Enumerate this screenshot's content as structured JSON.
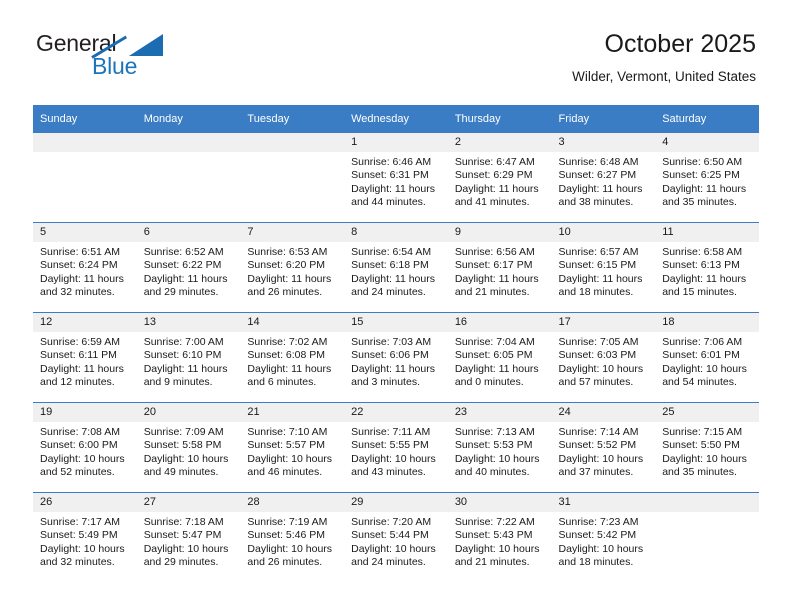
{
  "brand": {
    "name_part1": "General",
    "name_part2": "Blue"
  },
  "header": {
    "title": "October 2025",
    "location": "Wilder, Vermont, United States"
  },
  "weekday_headers": [
    "Sunday",
    "Monday",
    "Tuesday",
    "Wednesday",
    "Thursday",
    "Friday",
    "Saturday"
  ],
  "labels": {
    "sunrise_prefix": "Sunrise:",
    "sunset_prefix": "Sunset:",
    "daylight_prefix": "Daylight:"
  },
  "colors": {
    "header_blue": "#3b7dc4",
    "brand_blue": "#1b75bb",
    "daynum_bg": "#f0f0f0",
    "text": "#1a1a1a"
  },
  "weeks": [
    [
      {
        "day": "",
        "empty": true
      },
      {
        "day": "",
        "empty": true
      },
      {
        "day": "",
        "empty": true
      },
      {
        "day": "1",
        "sunrise": "Sunrise: 6:46 AM",
        "sunset": "Sunset: 6:31 PM",
        "daylight": "Daylight: 11 hours and 44 minutes."
      },
      {
        "day": "2",
        "sunrise": "Sunrise: 6:47 AM",
        "sunset": "Sunset: 6:29 PM",
        "daylight": "Daylight: 11 hours and 41 minutes."
      },
      {
        "day": "3",
        "sunrise": "Sunrise: 6:48 AM",
        "sunset": "Sunset: 6:27 PM",
        "daylight": "Daylight: 11 hours and 38 minutes."
      },
      {
        "day": "4",
        "sunrise": "Sunrise: 6:50 AM",
        "sunset": "Sunset: 6:25 PM",
        "daylight": "Daylight: 11 hours and 35 minutes."
      }
    ],
    [
      {
        "day": "5",
        "sunrise": "Sunrise: 6:51 AM",
        "sunset": "Sunset: 6:24 PM",
        "daylight": "Daylight: 11 hours and 32 minutes."
      },
      {
        "day": "6",
        "sunrise": "Sunrise: 6:52 AM",
        "sunset": "Sunset: 6:22 PM",
        "daylight": "Daylight: 11 hours and 29 minutes."
      },
      {
        "day": "7",
        "sunrise": "Sunrise: 6:53 AM",
        "sunset": "Sunset: 6:20 PM",
        "daylight": "Daylight: 11 hours and 26 minutes."
      },
      {
        "day": "8",
        "sunrise": "Sunrise: 6:54 AM",
        "sunset": "Sunset: 6:18 PM",
        "daylight": "Daylight: 11 hours and 24 minutes."
      },
      {
        "day": "9",
        "sunrise": "Sunrise: 6:56 AM",
        "sunset": "Sunset: 6:17 PM",
        "daylight": "Daylight: 11 hours and 21 minutes."
      },
      {
        "day": "10",
        "sunrise": "Sunrise: 6:57 AM",
        "sunset": "Sunset: 6:15 PM",
        "daylight": "Daylight: 11 hours and 18 minutes."
      },
      {
        "day": "11",
        "sunrise": "Sunrise: 6:58 AM",
        "sunset": "Sunset: 6:13 PM",
        "daylight": "Daylight: 11 hours and 15 minutes."
      }
    ],
    [
      {
        "day": "12",
        "sunrise": "Sunrise: 6:59 AM",
        "sunset": "Sunset: 6:11 PM",
        "daylight": "Daylight: 11 hours and 12 minutes."
      },
      {
        "day": "13",
        "sunrise": "Sunrise: 7:00 AM",
        "sunset": "Sunset: 6:10 PM",
        "daylight": "Daylight: 11 hours and 9 minutes."
      },
      {
        "day": "14",
        "sunrise": "Sunrise: 7:02 AM",
        "sunset": "Sunset: 6:08 PM",
        "daylight": "Daylight: 11 hours and 6 minutes."
      },
      {
        "day": "15",
        "sunrise": "Sunrise: 7:03 AM",
        "sunset": "Sunset: 6:06 PM",
        "daylight": "Daylight: 11 hours and 3 minutes."
      },
      {
        "day": "16",
        "sunrise": "Sunrise: 7:04 AM",
        "sunset": "Sunset: 6:05 PM",
        "daylight": "Daylight: 11 hours and 0 minutes."
      },
      {
        "day": "17",
        "sunrise": "Sunrise: 7:05 AM",
        "sunset": "Sunset: 6:03 PM",
        "daylight": "Daylight: 10 hours and 57 minutes."
      },
      {
        "day": "18",
        "sunrise": "Sunrise: 7:06 AM",
        "sunset": "Sunset: 6:01 PM",
        "daylight": "Daylight: 10 hours and 54 minutes."
      }
    ],
    [
      {
        "day": "19",
        "sunrise": "Sunrise: 7:08 AM",
        "sunset": "Sunset: 6:00 PM",
        "daylight": "Daylight: 10 hours and 52 minutes."
      },
      {
        "day": "20",
        "sunrise": "Sunrise: 7:09 AM",
        "sunset": "Sunset: 5:58 PM",
        "daylight": "Daylight: 10 hours and 49 minutes."
      },
      {
        "day": "21",
        "sunrise": "Sunrise: 7:10 AM",
        "sunset": "Sunset: 5:57 PM",
        "daylight": "Daylight: 10 hours and 46 minutes."
      },
      {
        "day": "22",
        "sunrise": "Sunrise: 7:11 AM",
        "sunset": "Sunset: 5:55 PM",
        "daylight": "Daylight: 10 hours and 43 minutes."
      },
      {
        "day": "23",
        "sunrise": "Sunrise: 7:13 AM",
        "sunset": "Sunset: 5:53 PM",
        "daylight": "Daylight: 10 hours and 40 minutes."
      },
      {
        "day": "24",
        "sunrise": "Sunrise: 7:14 AM",
        "sunset": "Sunset: 5:52 PM",
        "daylight": "Daylight: 10 hours and 37 minutes."
      },
      {
        "day": "25",
        "sunrise": "Sunrise: 7:15 AM",
        "sunset": "Sunset: 5:50 PM",
        "daylight": "Daylight: 10 hours and 35 minutes."
      }
    ],
    [
      {
        "day": "26",
        "sunrise": "Sunrise: 7:17 AM",
        "sunset": "Sunset: 5:49 PM",
        "daylight": "Daylight: 10 hours and 32 minutes."
      },
      {
        "day": "27",
        "sunrise": "Sunrise: 7:18 AM",
        "sunset": "Sunset: 5:47 PM",
        "daylight": "Daylight: 10 hours and 29 minutes."
      },
      {
        "day": "28",
        "sunrise": "Sunrise: 7:19 AM",
        "sunset": "Sunset: 5:46 PM",
        "daylight": "Daylight: 10 hours and 26 minutes."
      },
      {
        "day": "29",
        "sunrise": "Sunrise: 7:20 AM",
        "sunset": "Sunset: 5:44 PM",
        "daylight": "Daylight: 10 hours and 24 minutes."
      },
      {
        "day": "30",
        "sunrise": "Sunrise: 7:22 AM",
        "sunset": "Sunset: 5:43 PM",
        "daylight": "Daylight: 10 hours and 21 minutes."
      },
      {
        "day": "31",
        "sunrise": "Sunrise: 7:23 AM",
        "sunset": "Sunset: 5:42 PM",
        "daylight": "Daylight: 10 hours and 18 minutes."
      },
      {
        "day": "",
        "empty": true
      }
    ]
  ]
}
